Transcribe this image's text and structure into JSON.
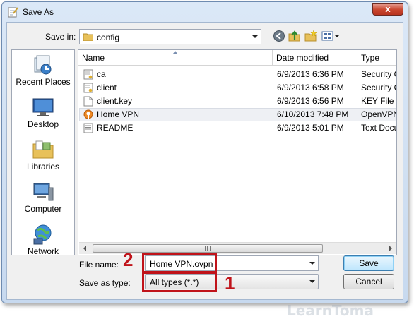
{
  "window": {
    "title": "Save As",
    "close_glyph": "x"
  },
  "toolbar": {
    "save_in_label": "Save in:",
    "save_in_value": "config",
    "icons": [
      "back-icon",
      "up-folder-icon",
      "new-folder-icon",
      "views-menu-icon"
    ]
  },
  "places": [
    {
      "label": "Recent Places",
      "icon": "recent-places-icon"
    },
    {
      "label": "Desktop",
      "icon": "desktop-icon"
    },
    {
      "label": "Libraries",
      "icon": "libraries-icon"
    },
    {
      "label": "Computer",
      "icon": "computer-icon"
    },
    {
      "label": "Network",
      "icon": "network-icon"
    }
  ],
  "columns": {
    "name": "Name",
    "date": "Date modified",
    "type": "Type"
  },
  "files": [
    {
      "name": "ca",
      "date": "6/9/2013 6:36 PM",
      "type": "Security C",
      "icon": "certificate-file-icon"
    },
    {
      "name": "client",
      "date": "6/9/2013 6:58 PM",
      "type": "Security C",
      "icon": "certificate-file-icon"
    },
    {
      "name": "client.key",
      "date": "6/9/2013 6:56 PM",
      "type": "KEY File",
      "icon": "blank-file-icon"
    },
    {
      "name": "Home VPN",
      "date": "6/10/2013 7:48 PM",
      "type": "OpenVPN",
      "icon": "openvpn-file-icon"
    },
    {
      "name": "README",
      "date": "6/9/2013 5:01 PM",
      "type": "Text Docu",
      "icon": "text-file-icon"
    }
  ],
  "filename": {
    "label": "File name:",
    "value": "Home VPN.ovpn"
  },
  "filetype": {
    "label": "Save as type:",
    "value": "All types (*.*)"
  },
  "buttons": {
    "save": "Save",
    "cancel": "Cancel"
  },
  "annotations": {
    "marker1": "1",
    "marker2": "2",
    "accent": "#c0131a"
  },
  "watermark": "LearnToma"
}
